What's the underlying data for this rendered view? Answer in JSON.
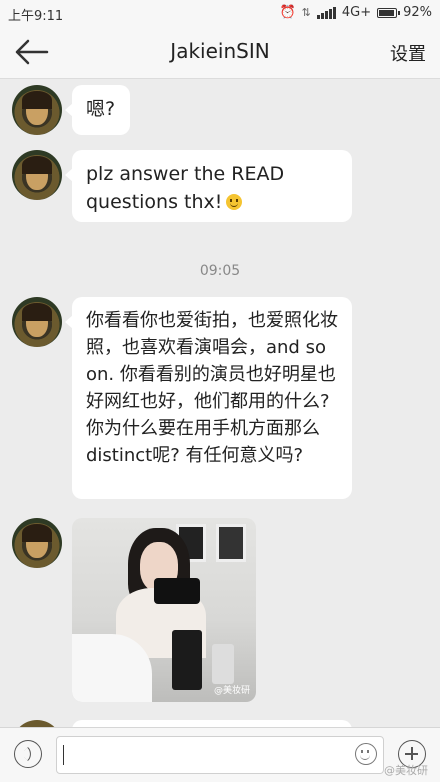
{
  "status_bar": {
    "time": "上午9:11",
    "network": "4G+",
    "battery": "92%",
    "battery_level": 0.92
  },
  "header": {
    "title": "JakieinSIN",
    "settings_label": "设置",
    "back_icon": "arrow-left-icon"
  },
  "messages": [
    {
      "type": "text",
      "text": "嗯?"
    },
    {
      "type": "text",
      "text": "plz answer the READ questions thx!",
      "emoji": "smile-emoji"
    },
    {
      "type": "timestamp",
      "text": "09:05"
    },
    {
      "type": "text",
      "text": "你看看你也爱街拍，也爱照化妆照，也喜欢看演唱会，and so on. 你看看别的演员也好明星也好网红也好，他们都用的什么? 你为什么要在用手机方面那么distinct呢? 有任何意义吗?"
    },
    {
      "type": "image",
      "watermark": "@美妆研"
    }
  ],
  "input_bar": {
    "voice_icon": "voice-icon",
    "emoji_icon": "emoji-icon",
    "plus_icon": "plus-icon"
  },
  "watermark": "@美妆研"
}
